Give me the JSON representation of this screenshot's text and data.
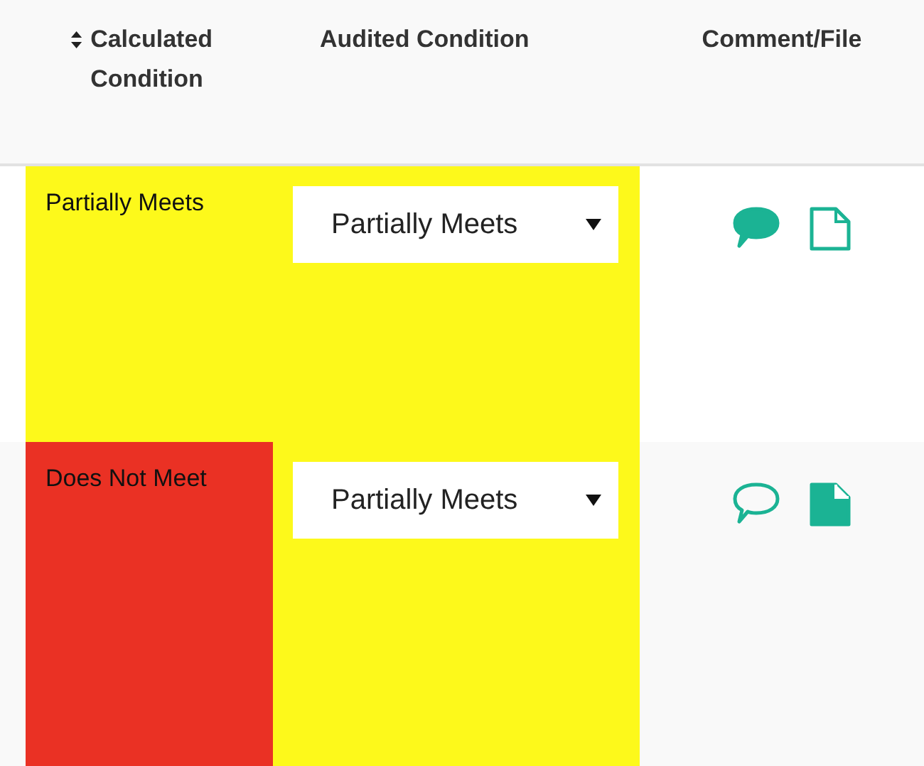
{
  "table": {
    "columns": [
      {
        "label": "Calculated Condition",
        "sortable": true
      },
      {
        "label": "Audited Condition",
        "sortable": false
      },
      {
        "label": "Comment/File",
        "sortable": false
      }
    ],
    "rows": [
      {
        "calculated": {
          "text": "Partially Meets",
          "color": "#fdf91b"
        },
        "audited": {
          "value": "Partially Meets",
          "color": "#fdf91b"
        },
        "has_comment": true,
        "has_file": false
      },
      {
        "calculated": {
          "text": "Does Not Meet",
          "color": "#ea3124"
        },
        "audited": {
          "value": "Partially Meets",
          "color": "#fdf91b"
        },
        "has_comment": false,
        "has_file": true
      }
    ]
  }
}
